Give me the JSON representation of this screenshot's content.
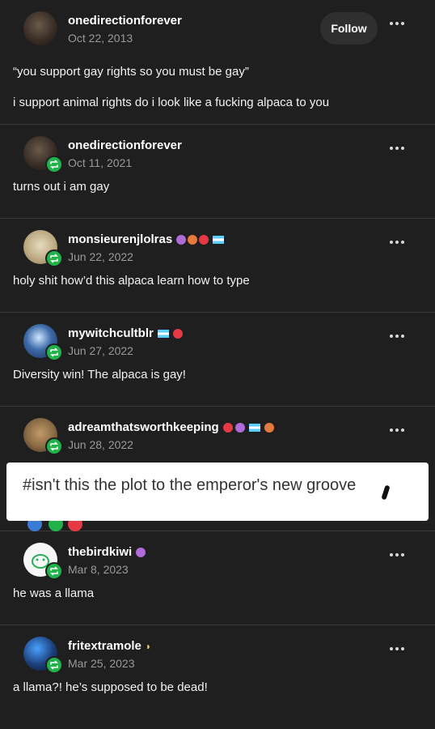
{
  "posts": [
    {
      "username": "onedirectionforever",
      "date": "Oct 22, 2013",
      "follow_label": "Follow",
      "lines": [
        "“you support gay rights so you must be gay”",
        "i support animal rights do i look like a fucking alpaca to you"
      ]
    },
    {
      "username": "onedirectionforever",
      "date": "Oct 11, 2021",
      "lines": [
        "turns out i am gay"
      ]
    },
    {
      "username": "monsieurenjlolras",
      "date": "Jun 22, 2022",
      "lines": [
        "holy shit how’d this alpaca learn how to type"
      ]
    },
    {
      "username": "mywitchcultblr",
      "date": "Jun 27, 2022",
      "lines": [
        "Diversity win! The alpaca is gay!"
      ]
    },
    {
      "username": "adreamthatsworthkeeping",
      "date": "Jun 28, 2022",
      "lines": []
    },
    {
      "username": "thebirdkiwi",
      "date": "Mar 8, 2023",
      "lines": [
        "he was a llama"
      ]
    },
    {
      "username": "fritextramole",
      "date": "Mar 25, 2023",
      "lines": [
        "a llama?! he’s supposed to be dead!"
      ]
    }
  ],
  "overlay": {
    "tag_text": "#isn't this the plot to the emperor's new groove"
  },
  "colors": {
    "background": "#1f1f1f",
    "reblog_green": "#22b24c",
    "date_gray": "#9a9a9a"
  },
  "icons": {
    "more": "more-options-icon",
    "reblog": "reblog-icon"
  }
}
